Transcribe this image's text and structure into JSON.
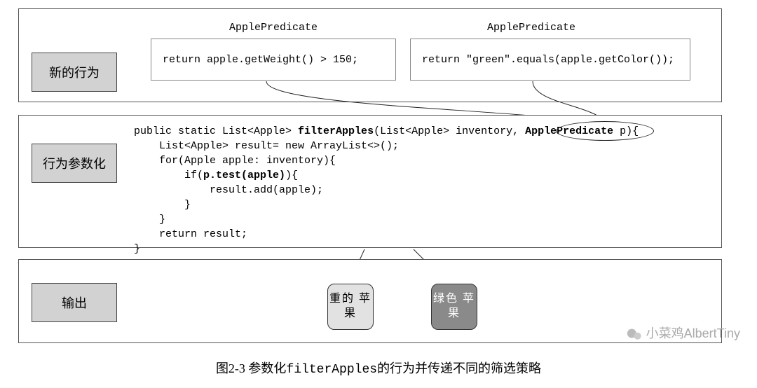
{
  "labels": {
    "top": "新的行为",
    "mid": "行为参数化",
    "bottom": "输出"
  },
  "predicate_header": "ApplePredicate",
  "code_box1": "return apple.getWeight() > 150;",
  "code_box2": "return \"green\".equals(apple.getColor());",
  "filter_code": {
    "sig_1": "public static List<Apple> ",
    "sig_b": "filterApples",
    "sig_2": "(List<Apple> inventory, ",
    "sig_3": "ApplePredicate ",
    "sig_4": "p){",
    "l2": "    List<Apple> result= new ArrayList<>();",
    "l3": "    for(Apple apple: inventory){",
    "l4_a": "        if(",
    "l4_b": "p.test(apple)",
    "l4_c": "){",
    "l5": "            result.add(apple);",
    "l6": "        }",
    "l7": "    }",
    "l8": "    return result;",
    "l9": "}"
  },
  "outputs": {
    "heavy": "重的\n苹果",
    "green": "绿色\n苹果"
  },
  "caption": {
    "prefix": "图2-3    参数化",
    "mono": "filterApples",
    "suffix": "的行为并传递不同的筛选策略"
  },
  "watermark": "小菜鸡AlbertTiny"
}
